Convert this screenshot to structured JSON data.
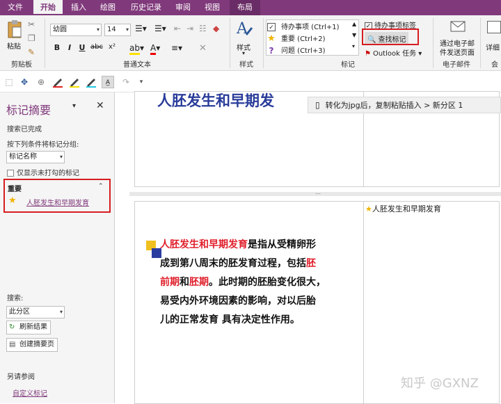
{
  "ribbon_tabs": [
    "文件",
    "开始",
    "插入",
    "绘图",
    "历史记录",
    "审阅",
    "视图",
    "布局"
  ],
  "active_tab": "开始",
  "clipboard": {
    "paste_label": "粘贴",
    "group_label": "剪贴板"
  },
  "font": {
    "family": "幼圆",
    "size": "14",
    "group_label": "普通文本",
    "bold": "B",
    "italic": "I",
    "underline": "U",
    "strike": "abc",
    "superscript": "x²"
  },
  "styles": {
    "label": "样式",
    "group_label": "样式"
  },
  "tags": {
    "items": [
      {
        "label": "待办事项 (Ctrl+1)",
        "icon": "checkbox-icon"
      },
      {
        "label": "重要 (Ctrl+2)",
        "icon": "star-icon"
      },
      {
        "label": "问题 (Ctrl+3)",
        "icon": "question-icon"
      }
    ],
    "todo_tag": "待办事项标签",
    "find_tags": "查找标记",
    "outlook_tasks": "Outlook 任务",
    "group_label": "标记"
  },
  "email": {
    "send_label_line1": "通过电子邮",
    "send_label_line2": "件发送页面",
    "group_label": "电子邮件",
    "meeting_label": "会",
    "details_label": "详细"
  },
  "pane": {
    "title": "标记摘要",
    "status": "搜索已完成",
    "group_by_label": "按下列条件将标记分组:",
    "group_by_value": "标记名称",
    "unchecked_only": "仅显示未打勾的标记",
    "section_header": "重要",
    "result_item": "人胚发生和早期发育",
    "search_label": "搜索:",
    "search_scope": "此分区",
    "refresh": "刷新结果",
    "create_summary": "创建摘要页",
    "see_also": "另请参阅",
    "custom_tags": "自定义标记"
  },
  "page": {
    "heading_partial": "人胚发生和早期发",
    "notice": "转化为jpg后，复制粘贴插入 > 新分区 1",
    "tagged_title": "人胚发生和早期发育",
    "body_rest1": "是指从受精卵形",
    "body_line2a": "成到第八周末的胚发育过程，包括",
    "body_line2b": "胚",
    "body_line3a": "前期",
    "body_line3b": "和",
    "body_line3c": "胚期",
    "body_line3d": "。此时期的胚胎变化很大，",
    "body_line4": "易受内外环境因素的影响，对以后胎",
    "body_line5": "儿的正常发育 具有决定性作用。",
    "side_tag_text": "人胚发生和早期发育"
  },
  "watermark": "知乎 @GXNZ",
  "colors": {
    "accent": "#80397b",
    "highlight_red": "#e0202c",
    "heading_blue": "#2a3c9a",
    "box_red": "#d71d20"
  }
}
